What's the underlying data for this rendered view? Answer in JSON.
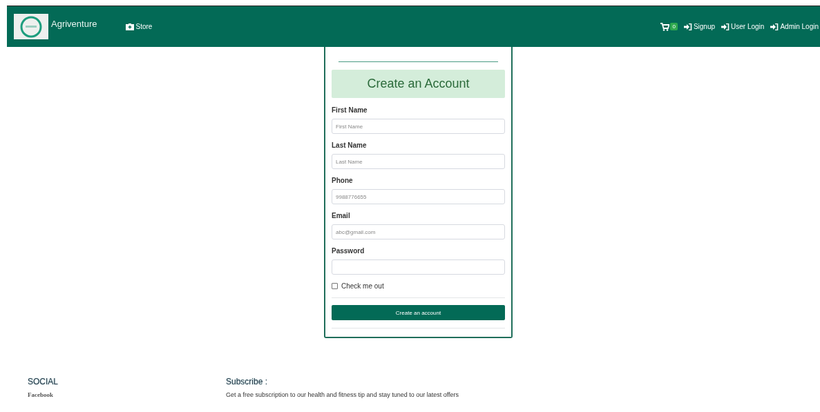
{
  "navbar": {
    "brand": "Agriventure",
    "store": {
      "label": "Store"
    },
    "cart": {
      "count": "0"
    },
    "links": [
      {
        "label": "Signup"
      },
      {
        "label": "User Login"
      },
      {
        "label": "Admin Login"
      }
    ]
  },
  "form": {
    "title": "Create an Account",
    "fields": [
      {
        "label": "First Name",
        "placeholder": "First Name"
      },
      {
        "label": "Last Name",
        "placeholder": "Last Name"
      },
      {
        "label": "Phone",
        "placeholder": "9988776655"
      },
      {
        "label": "Email",
        "placeholder": "abc@gmail.com"
      },
      {
        "label": "Password"
      }
    ],
    "checkbox": {
      "label": "Check me out",
      "checked": false
    },
    "submit": "Create an account"
  },
  "footer": {
    "social": {
      "heading": "SOCIAL",
      "links": [
        "Facebook"
      ]
    },
    "subscribe": {
      "heading": "Subscribe :",
      "text": "Get a free subscription to our health and fitness tip and stay tuned to our latest offers"
    }
  }
}
